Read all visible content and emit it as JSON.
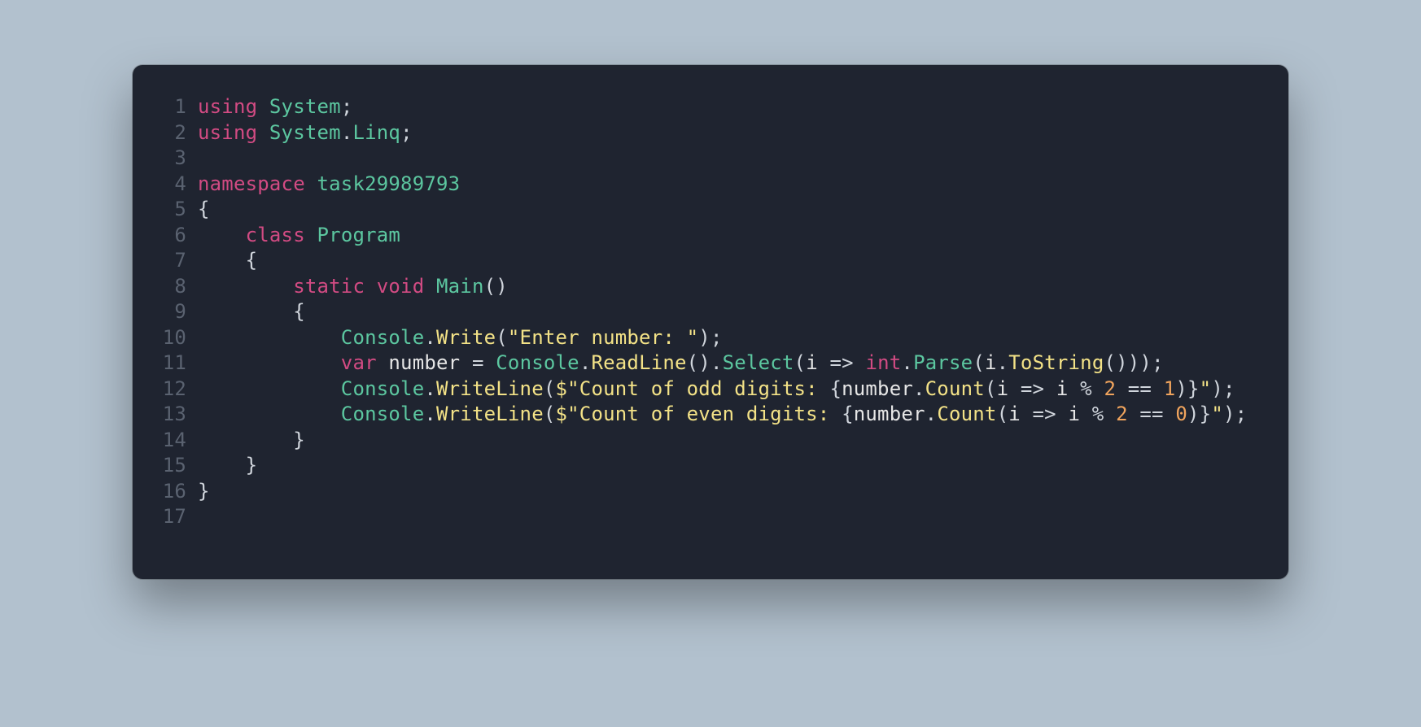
{
  "colors": {
    "background_page": "#b2c1ce",
    "background_editor": "#1f2430",
    "line_number": "#5a6270",
    "keyword": "#d24b83",
    "type": "#5cc7a0",
    "call": "#f3e287",
    "string": "#f3e287",
    "number": "#f0a45d",
    "default": "#d0d5dc"
  },
  "language": "csharp",
  "code_plain": "using System;\nusing System.Linq;\n\nnamespace task29989793\n{\n    class Program\n    {\n        static void Main()\n        {\n            Console.Write(\"Enter number: \");\n            var number = Console.ReadLine().Select(i => int.Parse(i.ToString()));\n            Console.WriteLine($\"Count of odd digits: {number.Count(i => i % 2 == 1)}\");\n            Console.WriteLine($\"Count of even digits: {number.Count(i => i % 2 == 0)}\");\n        }\n    }\n}\n",
  "lines": [
    {
      "n": "1",
      "tokens": [
        {
          "t": "using ",
          "c": "kw"
        },
        {
          "t": "System",
          "c": "type"
        },
        {
          "t": ";",
          "c": "pun"
        }
      ]
    },
    {
      "n": "2",
      "tokens": [
        {
          "t": "using ",
          "c": "kw"
        },
        {
          "t": "System",
          "c": "type"
        },
        {
          "t": ".",
          "c": "pun"
        },
        {
          "t": "Linq",
          "c": "type"
        },
        {
          "t": ";",
          "c": "pun"
        }
      ]
    },
    {
      "n": "3",
      "tokens": [
        {
          "t": "",
          "c": "pun"
        }
      ]
    },
    {
      "n": "4",
      "tokens": [
        {
          "t": "namespace ",
          "c": "kw"
        },
        {
          "t": "task29989793",
          "c": "type"
        }
      ]
    },
    {
      "n": "5",
      "tokens": [
        {
          "t": "{",
          "c": "pun"
        }
      ]
    },
    {
      "n": "6",
      "tokens": [
        {
          "t": "    ",
          "c": "pun"
        },
        {
          "t": "class ",
          "c": "kw"
        },
        {
          "t": "Program",
          "c": "type"
        }
      ]
    },
    {
      "n": "7",
      "tokens": [
        {
          "t": "    {",
          "c": "pun"
        }
      ]
    },
    {
      "n": "8",
      "tokens": [
        {
          "t": "        ",
          "c": "pun"
        },
        {
          "t": "static ",
          "c": "kw"
        },
        {
          "t": "void ",
          "c": "kw"
        },
        {
          "t": "Main",
          "c": "type"
        },
        {
          "t": "()",
          "c": "pun"
        }
      ]
    },
    {
      "n": "9",
      "tokens": [
        {
          "t": "        {",
          "c": "pun"
        }
      ]
    },
    {
      "n": "10",
      "tokens": [
        {
          "t": "            ",
          "c": "pun"
        },
        {
          "t": "Console",
          "c": "type"
        },
        {
          "t": ".",
          "c": "pun"
        },
        {
          "t": "Write",
          "c": "call"
        },
        {
          "t": "(",
          "c": "pun"
        },
        {
          "t": "\"Enter number: \"",
          "c": "str"
        },
        {
          "t": ");",
          "c": "pun"
        }
      ]
    },
    {
      "n": "11",
      "tokens": [
        {
          "t": "            ",
          "c": "pun"
        },
        {
          "t": "var ",
          "c": "kw"
        },
        {
          "t": "number",
          "c": "idv"
        },
        {
          "t": " = ",
          "c": "op"
        },
        {
          "t": "Console",
          "c": "type"
        },
        {
          "t": ".",
          "c": "pun"
        },
        {
          "t": "ReadLine",
          "c": "call"
        },
        {
          "t": "().",
          "c": "pun"
        },
        {
          "t": "Select",
          "c": "type"
        },
        {
          "t": "(",
          "c": "pun"
        },
        {
          "t": "i",
          "c": "prm"
        },
        {
          "t": " => ",
          "c": "op"
        },
        {
          "t": "int",
          "c": "kw"
        },
        {
          "t": ".",
          "c": "pun"
        },
        {
          "t": "Parse",
          "c": "type"
        },
        {
          "t": "(",
          "c": "pun"
        },
        {
          "t": "i",
          "c": "prm"
        },
        {
          "t": ".",
          "c": "pun"
        },
        {
          "t": "ToString",
          "c": "call"
        },
        {
          "t": "()));",
          "c": "pun"
        }
      ]
    },
    {
      "n": "12",
      "tokens": [
        {
          "t": "            ",
          "c": "pun"
        },
        {
          "t": "Console",
          "c": "type"
        },
        {
          "t": ".",
          "c": "pun"
        },
        {
          "t": "WriteLine",
          "c": "call"
        },
        {
          "t": "(",
          "c": "pun"
        },
        {
          "t": "$\"Count of odd digits: ",
          "c": "str"
        },
        {
          "t": "{",
          "c": "pun"
        },
        {
          "t": "number",
          "c": "idv"
        },
        {
          "t": ".",
          "c": "pun"
        },
        {
          "t": "Count",
          "c": "call"
        },
        {
          "t": "(",
          "c": "pun"
        },
        {
          "t": "i",
          "c": "prm"
        },
        {
          "t": " => ",
          "c": "op"
        },
        {
          "t": "i",
          "c": "prm"
        },
        {
          "t": " % ",
          "c": "op"
        },
        {
          "t": "2",
          "c": "num"
        },
        {
          "t": " == ",
          "c": "op"
        },
        {
          "t": "1",
          "c": "num"
        },
        {
          "t": ")",
          "c": "pun"
        },
        {
          "t": "}",
          "c": "pun"
        },
        {
          "t": "\"",
          "c": "str"
        },
        {
          "t": ");",
          "c": "pun"
        }
      ]
    },
    {
      "n": "13",
      "tokens": [
        {
          "t": "            ",
          "c": "pun"
        },
        {
          "t": "Console",
          "c": "type"
        },
        {
          "t": ".",
          "c": "pun"
        },
        {
          "t": "WriteLine",
          "c": "call"
        },
        {
          "t": "(",
          "c": "pun"
        },
        {
          "t": "$\"Count of even digits: ",
          "c": "str"
        },
        {
          "t": "{",
          "c": "pun"
        },
        {
          "t": "number",
          "c": "idv"
        },
        {
          "t": ".",
          "c": "pun"
        },
        {
          "t": "Count",
          "c": "call"
        },
        {
          "t": "(",
          "c": "pun"
        },
        {
          "t": "i",
          "c": "prm"
        },
        {
          "t": " => ",
          "c": "op"
        },
        {
          "t": "i",
          "c": "prm"
        },
        {
          "t": " % ",
          "c": "op"
        },
        {
          "t": "2",
          "c": "num"
        },
        {
          "t": " == ",
          "c": "op"
        },
        {
          "t": "0",
          "c": "num"
        },
        {
          "t": ")",
          "c": "pun"
        },
        {
          "t": "}",
          "c": "pun"
        },
        {
          "t": "\"",
          "c": "str"
        },
        {
          "t": ");",
          "c": "pun"
        }
      ]
    },
    {
      "n": "14",
      "tokens": [
        {
          "t": "        }",
          "c": "pun"
        }
      ]
    },
    {
      "n": "15",
      "tokens": [
        {
          "t": "    }",
          "c": "pun"
        }
      ]
    },
    {
      "n": "16",
      "tokens": [
        {
          "t": "}",
          "c": "pun"
        }
      ]
    },
    {
      "n": "17",
      "tokens": [
        {
          "t": "",
          "c": "pun"
        }
      ]
    }
  ]
}
